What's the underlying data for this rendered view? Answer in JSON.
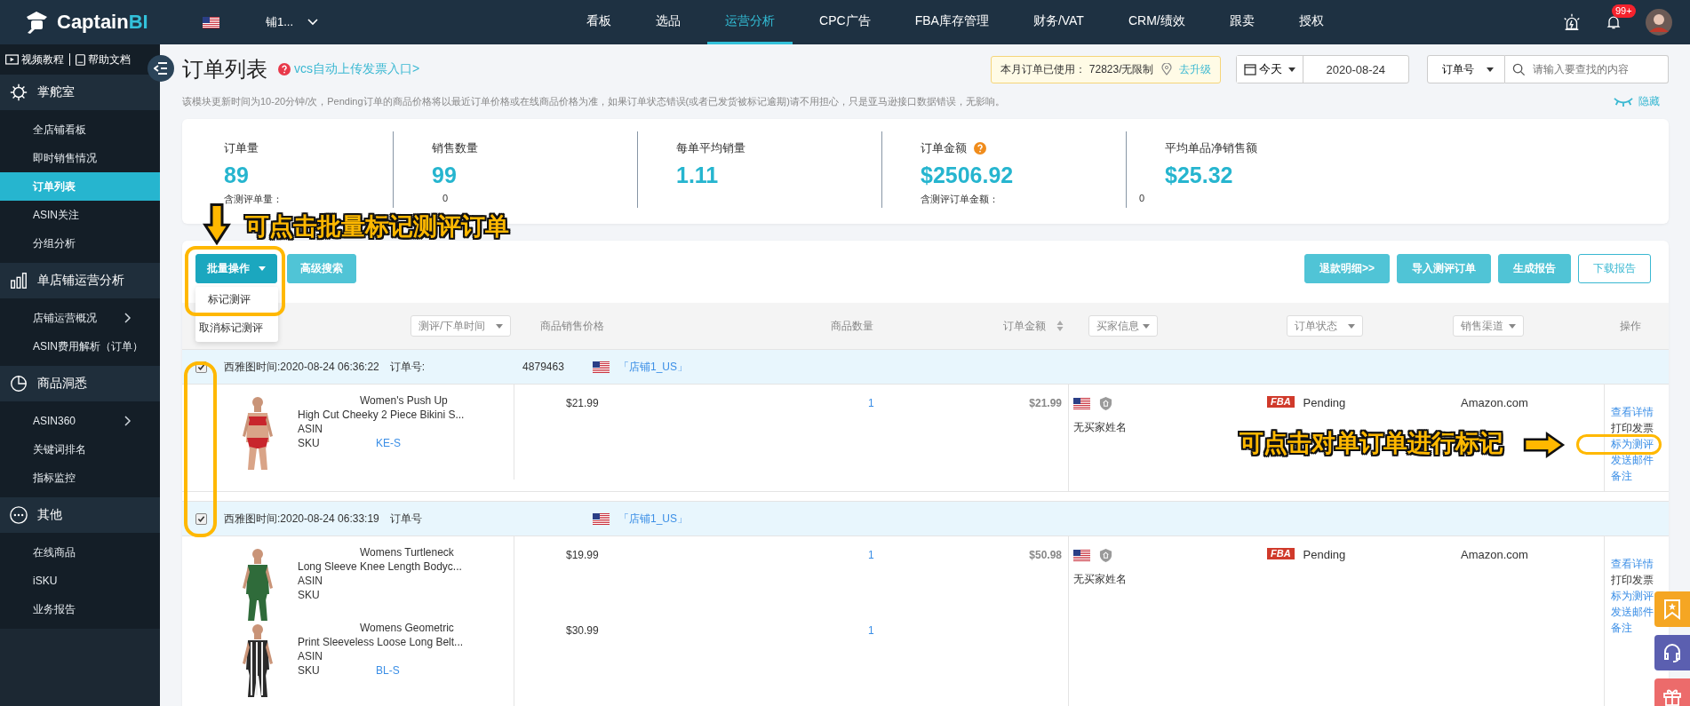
{
  "top_nav": {
    "logo": {
      "text": "Captain",
      "accent": "BI"
    },
    "store": "铺1...",
    "items": [
      {
        "label": "看板",
        "selected": false
      },
      {
        "label": "选品",
        "selected": false
      },
      {
        "label": "运营分析",
        "selected": true
      },
      {
        "label": "CPC广告",
        "selected": false
      },
      {
        "label": "FBA库存管理",
        "selected": false
      },
      {
        "label": "财务/VAT",
        "selected": false
      },
      {
        "label": "CRM/绩效",
        "selected": false
      },
      {
        "label": "跟卖",
        "selected": false
      },
      {
        "label": "授权",
        "selected": false
      }
    ],
    "badge": "99+"
  },
  "sidebar": {
    "links": [
      "视频教程",
      "帮助文档"
    ],
    "sections": [
      {
        "title": "掌舵室",
        "items": [
          {
            "label": "全店铺看板",
            "selected": false,
            "submenu": false
          },
          {
            "label": "即时销售情况",
            "selected": false,
            "submenu": false
          },
          {
            "label": "订单列表",
            "selected": true,
            "submenu": false
          },
          {
            "label": "ASIN关注",
            "selected": false,
            "submenu": false
          },
          {
            "label": "分组分析",
            "selected": false,
            "submenu": false
          }
        ]
      },
      {
        "title": "单店铺运营分析",
        "items": [
          {
            "label": "店铺运营概况",
            "selected": false,
            "submenu": true
          },
          {
            "label": "ASIN费用解析（订单）",
            "selected": false,
            "submenu": false
          }
        ]
      },
      {
        "title": "商品洞悉",
        "items": [
          {
            "label": "ASIN360",
            "selected": false,
            "submenu": true
          },
          {
            "label": "关键词排名",
            "selected": false,
            "submenu": false
          },
          {
            "label": "指标监控",
            "selected": false,
            "submenu": false
          }
        ]
      },
      {
        "title": "其他",
        "items": [
          {
            "label": "在线商品",
            "selected": false,
            "submenu": false
          },
          {
            "label": "iSKU",
            "selected": false,
            "submenu": false
          },
          {
            "label": "业务报告",
            "selected": false,
            "submenu": false
          }
        ]
      }
    ]
  },
  "page": {
    "title": "订单列表",
    "help_link": "vcs自动上传发票入口>",
    "notice": "该模块更新时间为10-20分钟/次，Pending订单的商品价格将以最近订单价格或在线商品价格为准，如果订单状态错误(或者已发货被标记逾期)请不用担心，只是亚马逊接口数据错误，无影响。",
    "hide_label": "隐藏"
  },
  "quota": {
    "text": "本月订单已使用： 72823/无限制",
    "upgrade": "去升级"
  },
  "date_filter": {
    "range": "今天",
    "date": "2020-08-24"
  },
  "search": {
    "field": "订单号",
    "placeholder": "请输入要查找的内容"
  },
  "stats": [
    {
      "label": "订单量",
      "value": "89",
      "help": false,
      "sub_label": "含测评单量：",
      "sub_value": "0"
    },
    {
      "label": "销售数量",
      "value": "99",
      "help": false
    },
    {
      "label": "每单平均销量",
      "value": "1.11",
      "help": false
    },
    {
      "label": "订单金额",
      "value": "$2506.92",
      "help": true,
      "sub_label": "含测评订单金额：",
      "sub_value": "0"
    },
    {
      "label": "平均单品净销售额",
      "value": "$25.32",
      "help": false
    }
  ],
  "toolbar": {
    "batch": "批量操作",
    "batch_menu": [
      "标记测评",
      "取消标记测评"
    ],
    "advanced": "高级搜索",
    "right_buttons": [
      {
        "label": "退款明细>>",
        "kind": "filled"
      },
      {
        "label": "导入测评订单",
        "kind": "filled"
      },
      {
        "label": "生成报告",
        "kind": "filled"
      },
      {
        "label": "下载报告",
        "kind": "outline"
      }
    ]
  },
  "table": {
    "columns": [
      {
        "label": "测评/下单时间",
        "kind": "select"
      },
      {
        "label": "商品销售价格",
        "kind": "plain"
      },
      {
        "label": "商品数量",
        "kind": "plain"
      },
      {
        "label": "订单金额",
        "kind": "sort"
      },
      {
        "label": "买家信息",
        "kind": "select"
      },
      {
        "label": "订单状态",
        "kind": "select"
      },
      {
        "label": "销售渠道",
        "kind": "select"
      },
      {
        "label": "操作",
        "kind": "plain"
      }
    ],
    "orders": [
      {
        "checked": true,
        "time": "西雅图时间:2020-08-24 06:36:22",
        "order_label": "订单号:",
        "order_no": "4879463",
        "store": "「店铺1_US」",
        "products": [
          {
            "title": [
              "Women's Push Up",
              "High Cut Cheeky 2 Piece Bikini S..."
            ],
            "asin_label": "ASIN",
            "sku_label": "SKU",
            "sku": "KE-S",
            "price": "$21.99",
            "qty": "1"
          }
        ],
        "amount": "$21.99",
        "buyer": "无买家姓名",
        "fulfillment": "FBA",
        "status": "Pending",
        "channel": "Amazon.com",
        "actions": [
          {
            "label": "查看详情",
            "kind": "link"
          },
          {
            "label": "打印发票",
            "kind": "plain"
          },
          {
            "label": "标为测评",
            "kind": "link"
          },
          {
            "label": "发送邮件",
            "kind": "link"
          },
          {
            "label": "备注",
            "kind": "link"
          }
        ]
      },
      {
        "checked": true,
        "time": "西雅图时间:2020-08-24 06:33:19",
        "order_label": "订单号",
        "store": "「店铺1_US」",
        "products": [
          {
            "title": [
              "Womens Turtleneck",
              "Long Sleeve Knee Length Bodyc..."
            ],
            "asin_label": "ASIN",
            "sku_label": "SKU",
            "price": "$19.99",
            "qty": "1"
          },
          {
            "title": [
              "Womens Geometric",
              "Print Sleeveless Loose Long Belt..."
            ],
            "asin_label": "ASIN",
            "sku_label": "SKU",
            "sku": "BL-S",
            "price": "$30.99",
            "qty": "1"
          }
        ],
        "amount": "$50.98",
        "buyer": "无买家姓名",
        "fulfillment": "FBA",
        "status": "Pending",
        "channel": "Amazon.com",
        "actions": [
          {
            "label": "查看详情",
            "kind": "link"
          },
          {
            "label": "打印发票",
            "kind": "plain"
          },
          {
            "label": "标为测评",
            "kind": "link"
          },
          {
            "label": "发送邮件",
            "kind": "link"
          },
          {
            "label": "备注",
            "kind": "link"
          }
        ]
      }
    ]
  },
  "annotations": [
    {
      "text": "可点击批量标记测评订单",
      "kind": "down"
    },
    {
      "text": "可点击对单订单进行标记",
      "kind": "right"
    }
  ]
}
